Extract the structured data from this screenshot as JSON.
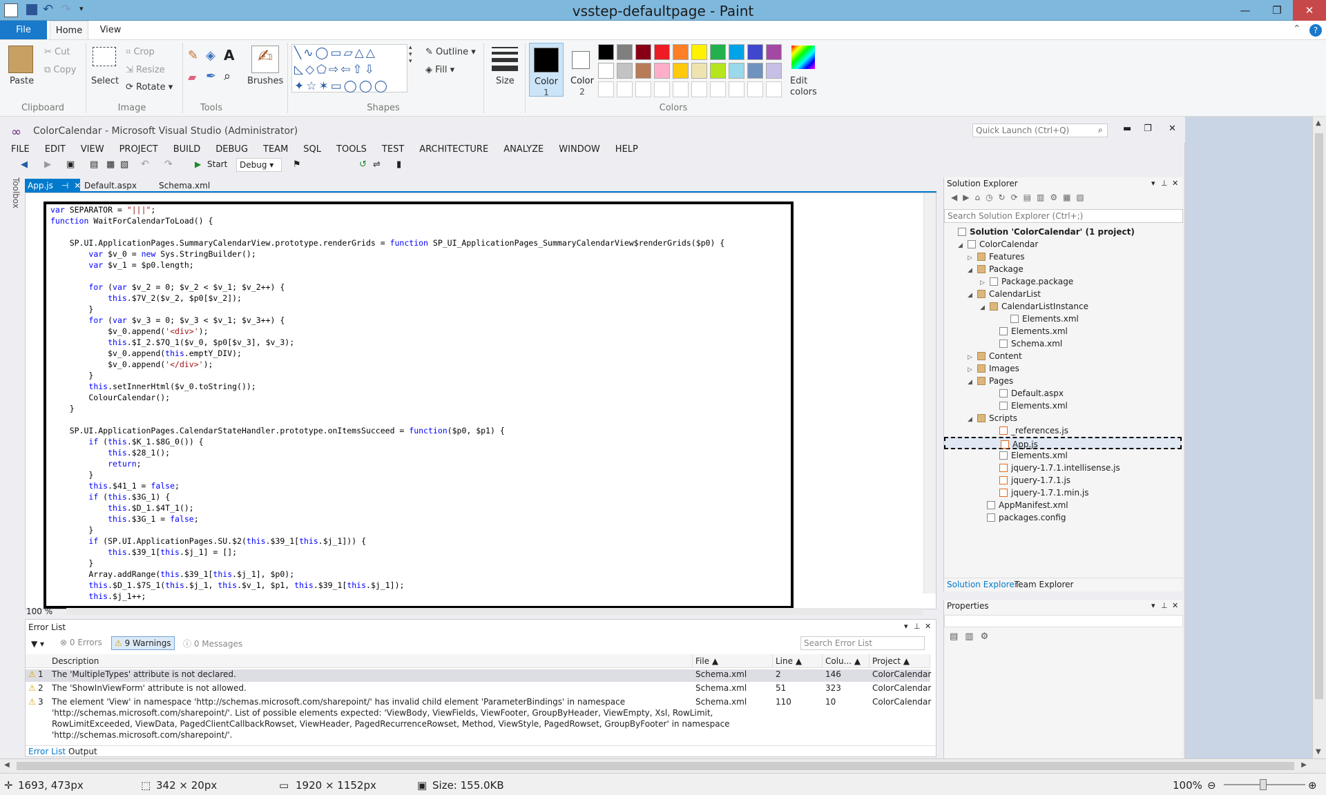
{
  "paint": {
    "window_title": "vsstep-defaultpage - Paint",
    "tabs": {
      "file": "File",
      "home": "Home",
      "view": "View"
    },
    "clipboard": {
      "paste": "Paste",
      "cut": "Cut",
      "copy": "Copy",
      "group": "Clipboard"
    },
    "image": {
      "select": "Select",
      "crop": "Crop",
      "resize": "Resize",
      "rotate": "Rotate",
      "group": "Image"
    },
    "tools": {
      "group": "Tools"
    },
    "brushes": "Brushes",
    "shapes": {
      "outline": "Outline",
      "fill": "Fill",
      "group": "Shapes"
    },
    "size": "Size",
    "color1": "Color",
    "color1_num": "1",
    "color2": "Color",
    "color2_num": "2",
    "edit_colors": "Edit",
    "edit_colors2": "colors",
    "colors_group": "Colors",
    "palette": [
      "#000000",
      "#7f7f7f",
      "#880015",
      "#ed1c24",
      "#ff7f27",
      "#fff200",
      "#22b14c",
      "#00a2e8",
      "#3f48cc",
      "#a349a4",
      "#ffffff",
      "#c3c3c3",
      "#b97a57",
      "#ffaec9",
      "#ffc90e",
      "#efe4b0",
      "#b5e61d",
      "#99d9ea",
      "#7092be",
      "#c8bfe7"
    ],
    "status": {
      "cursor": "1693, 473px",
      "selection": "342 × 20px",
      "canvas": "1920 × 1152px",
      "size": "Size: 155.0KB",
      "zoom": "100%"
    }
  },
  "vs": {
    "title": "ColorCalendar - Microsoft Visual Studio (Administrator)",
    "quick_launch": "Quick Launch (Ctrl+Q)",
    "menu": [
      "FILE",
      "EDIT",
      "VIEW",
      "PROJECT",
      "BUILD",
      "DEBUG",
      "TEAM",
      "SQL",
      "TOOLS",
      "TEST",
      "ARCHITECTURE",
      "ANALYZE",
      "WINDOW",
      "HELP"
    ],
    "start": "Start",
    "config": "Debug",
    "toolbox": "Toolbox",
    "doc_tabs": [
      "App.js",
      "Default.aspx",
      "Schema.xml"
    ],
    "zoom": "100 %",
    "code": [
      "var SEPARATOR = \"|||\";",
      "function WaitForCalendarToLoad() {",
      "",
      "    SP.UI.ApplicationPages.SummaryCalendarView.prototype.renderGrids = function SP_UI_ApplicationPages_SummaryCalendarView$renderGrids($p0) {",
      "        var $v_0 = new Sys.StringBuilder();",
      "        var $v_1 = $p0.length;",
      "",
      "        for (var $v_2 = 0; $v_2 < $v_1; $v_2++) {",
      "            this.$7V_2($v_2, $p0[$v_2]);",
      "        }",
      "        for (var $v_3 = 0; $v_3 < $v_1; $v_3++) {",
      "            $v_0.append('<div>');",
      "            this.$I_2.$7Q_1($v_0, $p0[$v_3], $v_3);",
      "            $v_0.append(this.emptY_DIV);",
      "            $v_0.append('</div>');",
      "        }",
      "        this.setInnerHtml($v_0.toString());",
      "        ColourCalendar();",
      "    }",
      "",
      "    SP.UI.ApplicationPages.CalendarStateHandler.prototype.onItemsSucceed = function($p0, $p1) {",
      "        if (this.$K_1.$8G_0()) {",
      "            this.$28_1();",
      "            return;",
      "        }",
      "        this.$41_1 = false;",
      "        if (this.$3G_1) {",
      "            this.$D_1.$4T_1();",
      "            this.$3G_1 = false;",
      "        }",
      "        if (SP.UI.ApplicationPages.SU.$2(this.$39_1[this.$j_1])) {",
      "            this.$39_1[this.$j_1] = [];",
      "        }",
      "        Array.addRange(this.$39_1[this.$j_1], $p0);",
      "        this.$D_1.$7S_1(this.$j_1, this.$v_1, $p1, this.$39_1[this.$j_1]);",
      "        this.$j_1++;"
    ],
    "error_list": {
      "title": "Error List",
      "errors": "0 Errors",
      "warnings": "9 Warnings",
      "messages": "0 Messages",
      "search": "Search Error List",
      "headers": [
        "Description",
        "File",
        "Line",
        "Colu...",
        "Project"
      ],
      "rows": [
        {
          "n": "1",
          "desc": "The 'MultipleTypes' attribute is not declared.",
          "file": "Schema.xml",
          "line": "2",
          "col": "146",
          "project": "ColorCalendar"
        },
        {
          "n": "2",
          "desc": "The 'ShowInViewForm' attribute is not allowed.",
          "file": "Schema.xml",
          "line": "51",
          "col": "323",
          "project": "ColorCalendar"
        },
        {
          "n": "3",
          "desc": "The element 'View' in namespace 'http://schemas.microsoft.com/sharepoint/' has invalid child element 'ParameterBindings' in namespace",
          "desc2": "'http://schemas.microsoft.com/sharepoint/'. List of possible elements expected: 'ViewBody, ViewFields, ViewFooter, GroupByHeader, ViewEmpty, Xsl, RowLimit,",
          "desc3": "RowLimitExceeded, ViewData, PagedClientCallbackRowset, ViewHeader, PagedRecurrenceRowset, Method, ViewStyle, PagedRowset, GroupByFooter' in namespace",
          "desc4": "'http://schemas.microsoft.com/sharepoint/'.",
          "file": "Schema.xml",
          "line": "110",
          "col": "10",
          "project": "ColorCalendar"
        }
      ],
      "bottom_tabs": [
        "Error List",
        "Output"
      ]
    },
    "solution_explorer": {
      "title": "Solution Explorer",
      "search": "Search Solution Explorer (Ctrl+;)",
      "tree": [
        {
          "label": "Solution 'ColorCalendar' (1 project)",
          "bold": true
        },
        {
          "label": "ColorCalendar"
        },
        {
          "label": "Features"
        },
        {
          "label": "Package"
        },
        {
          "label": "Package.package"
        },
        {
          "label": "CalendarList"
        },
        {
          "label": "CalendarListInstance"
        },
        {
          "label": "Elements.xml"
        },
        {
          "label": "Elements.xml"
        },
        {
          "label": "Schema.xml"
        },
        {
          "label": "Content"
        },
        {
          "label": "Images"
        },
        {
          "label": "Pages"
        },
        {
          "label": "Default.aspx"
        },
        {
          "label": "Elements.xml"
        },
        {
          "label": "Scripts"
        },
        {
          "label": "_references.js"
        },
        {
          "label": "App.js"
        },
        {
          "label": "Elements.xml"
        },
        {
          "label": "jquery-1.7.1.intellisense.js"
        },
        {
          "label": "jquery-1.7.1.js"
        },
        {
          "label": "jquery-1.7.1.min.js"
        },
        {
          "label": "AppManifest.xml"
        },
        {
          "label": "packages.config"
        }
      ],
      "bottom_tabs": [
        "Solution Explorer",
        "Team Explorer"
      ]
    },
    "properties": "Properties"
  }
}
